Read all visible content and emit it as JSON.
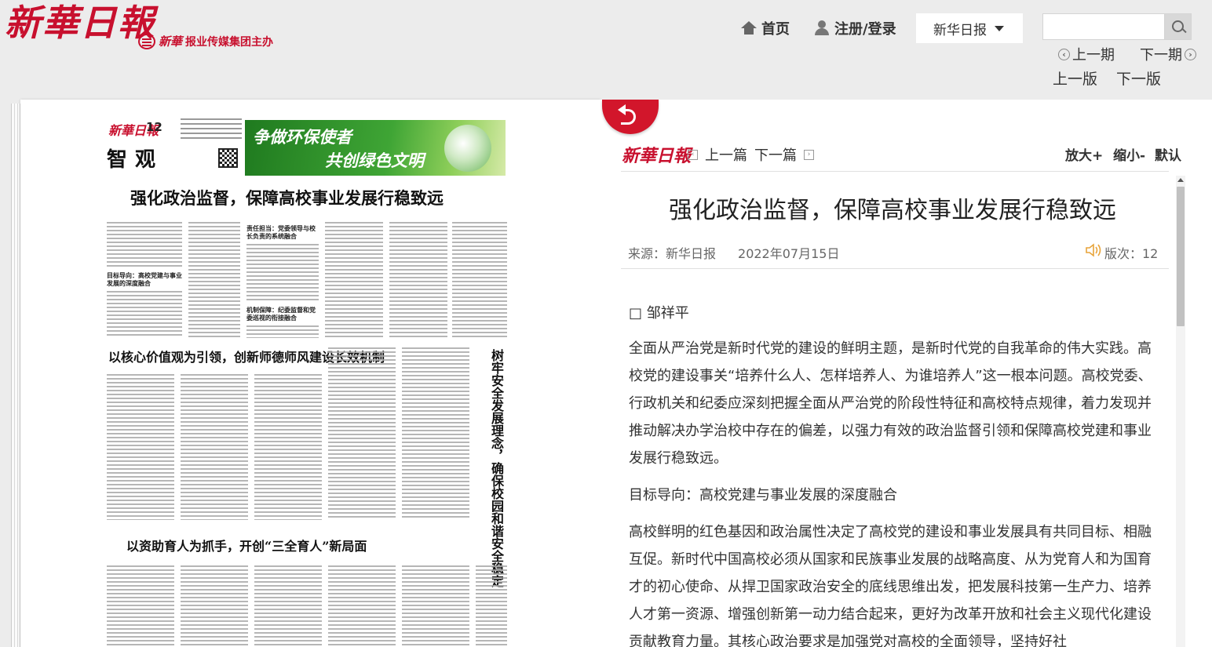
{
  "header": {
    "logo_text": "新華日報",
    "group_brand": "新華",
    "group_text": "报业传媒集团主办",
    "nav": {
      "home": "首页",
      "login": "注册/登录"
    },
    "paper_select": "新华日报",
    "search": {
      "placeholder": ""
    },
    "issue_prev": "上一期",
    "issue_next": "下一期",
    "page_prev": "上一版",
    "page_next": "下一版"
  },
  "paper": {
    "masthead": "新華日報",
    "page_number": "12",
    "column_name": "智观",
    "banner_line1": "争做环保使者",
    "banner_line2": "共创绿色文明",
    "headline_main": "强化政治监督，保障高校事业发展行稳致远",
    "headline_2": "以核心价值观为引领，创新师德师风建设长效机制",
    "headline_3": "以资助育人为抓手，开创“三全育人”新局面",
    "headline_vertical": "树牢安全发展理念，确保校园和谐安全稳定",
    "sub_1": "目标导向：高校党建与事业发展的深度融合",
    "sub_2": "责任担当：党委领导与校长负责的系统融合",
    "sub_3": "机制保障：纪委监督和党委巡视的衔接融合"
  },
  "article": {
    "logo": "新華日報",
    "prev": "上一篇",
    "next": "下一篇",
    "zoom_in": "放大+",
    "zoom_out": "缩小-",
    "zoom_default": "默认",
    "title": "强化政治监督，保障高校事业发展行稳致远",
    "source": "来源：新华日报",
    "date": "2022年07月15日",
    "page_label": "版次：12",
    "author": "□ 邹祥平",
    "para1": "全面从严治党是新时代党的建设的鲜明主题，是新时代党的自我革命的伟大实践。高校党的建设事关“培养什么人、怎样培养人、为谁培养人”这一根本问题。高校党委、行政机关和纪委应深刻把握全面从严治党的阶段性特征和高校特点规律，着力发现并推动解决办学治校中存在的偏差，以强力有效的政治监督引领和保障高校党建和事业发展行稳致远。",
    "subhead1": "目标导向：高校党建与事业发展的深度融合",
    "para2": "高校鲜明的红色基因和政治属性决定了高校党的建设和事业发展具有共同目标、相融互促。新时代中国高校必须从国家和民族事业发展的战略高度、从为党育人和为国育才的初心使命、从捍卫国家政治安全的底线思维出发，把发展科技第一生产力、培养人才第一资源、增强创新第一动力结合起来，更好为改革开放和社会主义现代化建设贡献教育力量。其核心政治要求是加强党对高校的全面领导，坚持好社"
  },
  "colors": {
    "brand_red": "#c8102e",
    "back_button": "#d2162b"
  },
  "icons": [
    "home-icon",
    "user-icon",
    "search-icon",
    "chevron-down-icon",
    "back-arrow-icon",
    "speaker-icon",
    "circle-arrow-left-icon",
    "circle-arrow-right-icon"
  ]
}
